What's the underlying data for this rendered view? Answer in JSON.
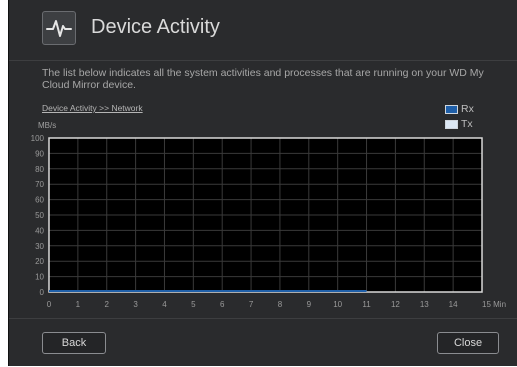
{
  "dialog": {
    "title": "Device Activity",
    "icon": "activity-pulse-icon",
    "description": "The list below indicates all the system activities and processes that are running on your WD My Cloud Mirror device.",
    "breadcrumb": "Device Activity >> Network"
  },
  "chart_data": {
    "type": "line",
    "ylabel": "MB/s",
    "xlabel": "",
    "x_unit_label": "Min",
    "ylim": [
      0,
      100
    ],
    "xlim": [
      0,
      15
    ],
    "yticks": [
      0,
      10,
      20,
      30,
      40,
      50,
      60,
      70,
      80,
      90,
      100
    ],
    "xticks": [
      0,
      1,
      2,
      3,
      4,
      5,
      6,
      7,
      8,
      9,
      10,
      11,
      12,
      13,
      14,
      15
    ],
    "grid": true,
    "legend_position": "top-right",
    "series": [
      {
        "name": "Rx",
        "color": "#1f5fa8",
        "x": [
          0,
          1,
          2,
          3,
          4,
          5,
          6,
          7,
          8,
          9,
          10,
          11
        ],
        "y": [
          0,
          0,
          0,
          0,
          0,
          0,
          0,
          0,
          0,
          0,
          0,
          0
        ]
      },
      {
        "name": "Tx",
        "color": "#dce8f4",
        "x": [
          0,
          1,
          2,
          3,
          4,
          5,
          6,
          7,
          8,
          9,
          10,
          11
        ],
        "y": [
          0,
          0,
          0,
          0,
          0,
          0,
          0,
          0,
          0,
          0,
          0,
          0
        ]
      }
    ]
  },
  "colors": {
    "background": "#2a2b2d",
    "plot_background": "#000000",
    "plot_border": "#d9d9d9",
    "grid": "#3a3a3a"
  },
  "footer": {
    "back_label": "Back",
    "close_label": "Close"
  }
}
